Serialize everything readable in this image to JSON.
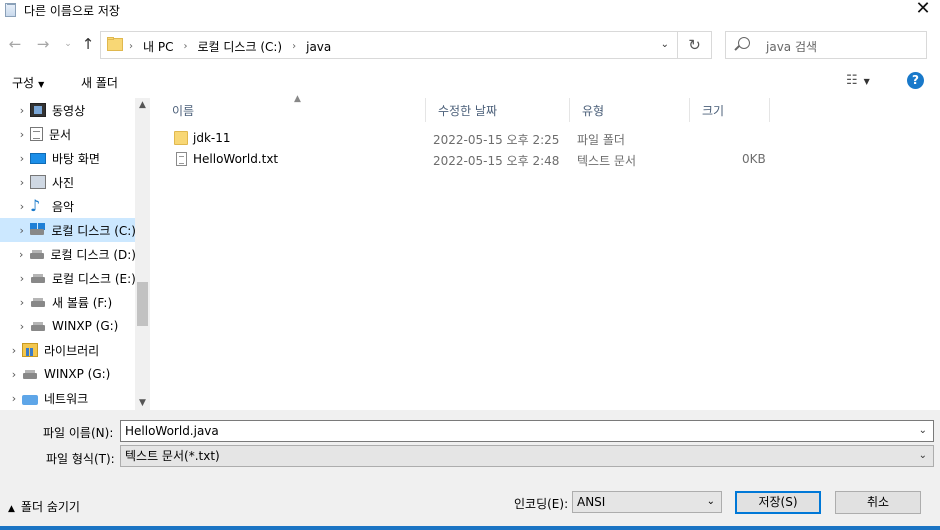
{
  "window": {
    "title": "다른 이름으로 저장"
  },
  "nav": {
    "breadcrumbs": [
      "내 PC",
      "로컬 디스크 (C:)",
      "java"
    ],
    "search_placeholder": "java 검색"
  },
  "toolbar": {
    "organize": "구성",
    "new_folder": "새 폴더",
    "help": "?"
  },
  "sidebar": {
    "items": [
      {
        "label": "동영상",
        "icon": "video-icon",
        "chevron": true,
        "indent": 1
      },
      {
        "label": "문서",
        "icon": "document-icon",
        "chevron": true,
        "indent": 1
      },
      {
        "label": "바탕 화면",
        "icon": "desktop-icon",
        "chevron": true,
        "indent": 1
      },
      {
        "label": "사진",
        "icon": "picture-icon",
        "chevron": true,
        "indent": 1
      },
      {
        "label": "음악",
        "icon": "music-icon",
        "chevron": true,
        "indent": 1
      },
      {
        "label": "로컬 디스크 (C:)",
        "icon": "windows-drive-icon",
        "chevron": true,
        "indent": 1,
        "selected": true
      },
      {
        "label": "로컬 디스크 (D:)",
        "icon": "drive-icon",
        "chevron": true,
        "indent": 1
      },
      {
        "label": "로컬 디스크 (E:)",
        "icon": "drive-icon",
        "chevron": true,
        "indent": 1
      },
      {
        "label": "새 볼륨 (F:)",
        "icon": "drive-icon",
        "chevron": true,
        "indent": 1
      },
      {
        "label": "WINXP (G:)",
        "icon": "drive-icon",
        "chevron": true,
        "indent": 1
      },
      {
        "label": "라이브러리",
        "icon": "library-icon",
        "chevron": true,
        "indent": 0
      },
      {
        "label": "WINXP (G:)",
        "icon": "drive-icon",
        "chevron": true,
        "indent": 0
      },
      {
        "label": "네트워크",
        "icon": "network-icon",
        "chevron": true,
        "indent": 0
      }
    ]
  },
  "file_list": {
    "columns": [
      "이름",
      "수정한 날짜",
      "유형",
      "크기"
    ],
    "rows": [
      {
        "name": "jdk-11",
        "modified": "2022-05-15 오후 2:25",
        "type": "파일 폴더",
        "size": "",
        "icon": "folder-icon"
      },
      {
        "name": "HelloWorld.txt",
        "modified": "2022-05-15 오후 2:48",
        "type": "텍스트 문서",
        "size": "0KB",
        "icon": "text-file-icon"
      }
    ]
  },
  "form": {
    "filename_label": "파일 이름(N):",
    "filename_value": "HelloWorld.java",
    "filetype_label": "파일 형식(T):",
    "filetype_value": "텍스트 문서(*.txt)",
    "hide_folders": "폴더 숨기기",
    "encoding_label": "인코딩(E):",
    "encoding_value": "ANSI",
    "save_button": "저장(S)",
    "cancel_button": "취소"
  },
  "colors": {
    "accent": "#0078d7",
    "selection": "#cce8ff",
    "help": "#1979ca"
  }
}
